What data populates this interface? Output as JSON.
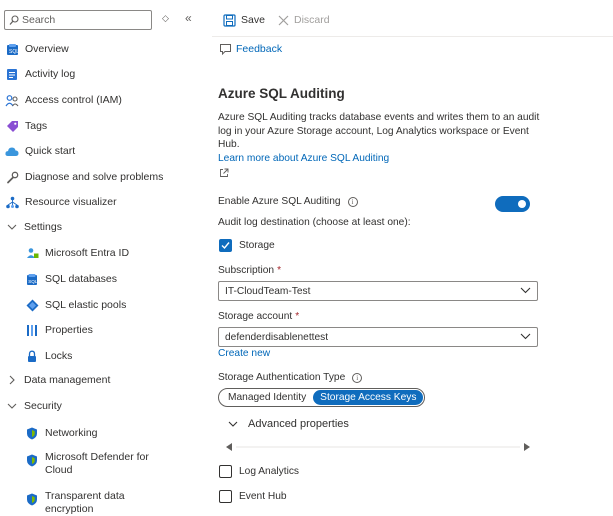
{
  "sidebar": {
    "search_placeholder": "Search",
    "items": [
      {
        "label": "Overview",
        "icon": "sql-database-icon"
      },
      {
        "label": "Activity log",
        "icon": "activity-log-icon"
      },
      {
        "label": "Access control (IAM)",
        "icon": "people-icon"
      },
      {
        "label": "Tags",
        "icon": "tag-icon"
      },
      {
        "label": "Quick start",
        "icon": "cloud-icon"
      },
      {
        "label": "Diagnose and solve problems",
        "icon": "wrench-icon"
      },
      {
        "label": "Resource visualizer",
        "icon": "hierarchy-icon"
      }
    ],
    "settings_group": {
      "label": "Settings",
      "items": [
        {
          "label": "Microsoft Entra ID",
          "icon": "entra-id-icon"
        },
        {
          "label": "SQL databases",
          "icon": "sql-database-icon"
        },
        {
          "label": "SQL elastic pools",
          "icon": "elastic-pool-icon"
        },
        {
          "label": "Properties",
          "icon": "properties-icon"
        },
        {
          "label": "Locks",
          "icon": "lock-icon"
        }
      ]
    },
    "data_management_group": {
      "label": "Data management"
    },
    "security_group": {
      "label": "Security",
      "items": [
        {
          "label": "Networking",
          "icon": "shield-icon"
        },
        {
          "label": "Microsoft Defender for Cloud",
          "icon": "shield-icon"
        },
        {
          "label": "Transparent data encryption",
          "icon": "shield-icon"
        }
      ]
    }
  },
  "toolbar": {
    "save_label": "Save",
    "discard_label": "Discard",
    "feedback_label": "Feedback"
  },
  "main": {
    "title": "Azure SQL Auditing",
    "description": "Azure SQL Auditing tracks database events and writes them to an audit log in your Azure Storage account, Log Analytics workspace or Event Hub.",
    "learn_more": "Learn more about Azure SQL Auditing",
    "enable_label": "Enable Azure SQL Auditing",
    "enable_value": true,
    "destination_label": "Audit log destination (choose at least one):",
    "storage_label": "Storage",
    "storage_checked": true,
    "subscription_label": "Subscription",
    "subscription_value": "IT-CloudTeam-Test",
    "storage_account_label": "Storage account",
    "storage_account_value": "defenderdisablenettest",
    "create_new": "Create new",
    "auth_type_label": "Storage Authentication Type",
    "auth_options": [
      "Managed Identity",
      "Storage Access Keys"
    ],
    "auth_selected": "Storage Access Keys",
    "advanced_label": "Advanced properties",
    "log_analytics_label": "Log Analytics",
    "log_analytics_checked": false,
    "event_hub_label": "Event Hub",
    "event_hub_checked": false,
    "required_marker": "*",
    "info_glyph": "i"
  },
  "colors": {
    "accent": "#0f6cbd",
    "link": "#0067b8",
    "required": "#a4262c",
    "text": "#323130"
  }
}
